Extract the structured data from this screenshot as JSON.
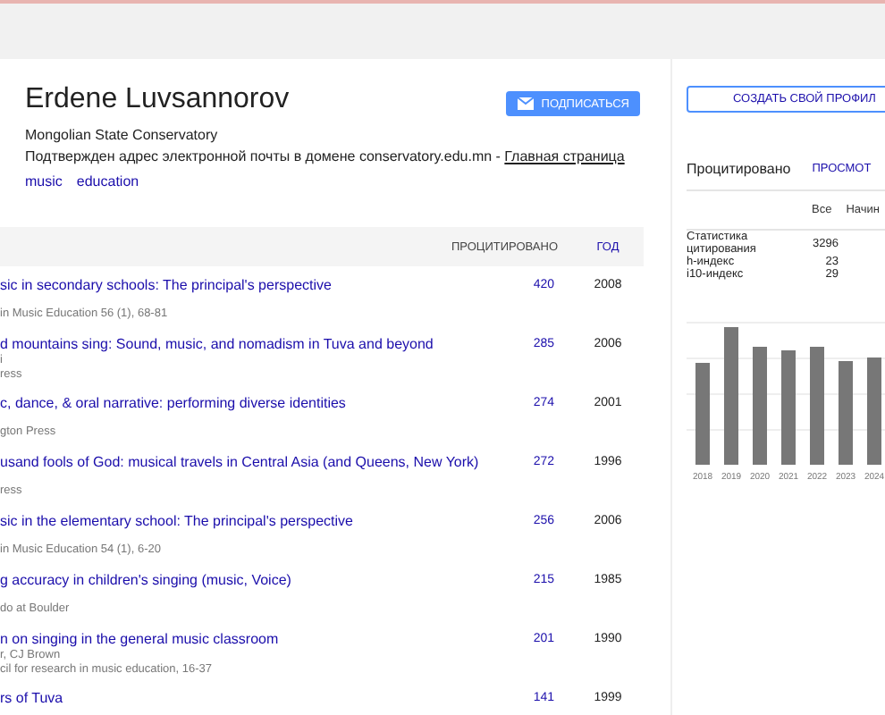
{
  "profile": {
    "name": "Erdene Luvsannorov",
    "affiliation": "Mongolian State Conservatory",
    "verified": "Подтвержден адрес электронной почты в домене conservatory.edu.mn - ",
    "homepage_link": "Главная страница",
    "interests": [
      "music",
      "education"
    ],
    "follow_button": "ПОДПИСАТЬСЯ"
  },
  "table": {
    "columns": [
      "ПРОЦИТИРОВАНО",
      "ГОД"
    ],
    "rows": [
      {
        "title": "sic in secondary schools: The principal's perspective",
        "lines": [
          "in Music Education 56 (1), 68-81"
        ],
        "cited": "420",
        "year": "2008"
      },
      {
        "title": "d mountains sing: Sound, music, and nomadism in Tuva and beyond",
        "lines": [
          "i",
          "ress"
        ],
        "cited": "285",
        "year": "2006"
      },
      {
        "title": "c, dance, & oral narrative: performing diverse identities",
        "lines": [
          "gton Press"
        ],
        "cited": "274",
        "year": "2001"
      },
      {
        "title": "usand fools of God: musical travels in Central Asia (and Queens, New York)",
        "lines": [
          "ress"
        ],
        "cited": "272",
        "year": "1996"
      },
      {
        "title": "sic in the elementary school: The principal's perspective",
        "lines": [
          "in Music Education 54 (1), 6-20"
        ],
        "cited": "256",
        "year": "2006"
      },
      {
        "title": "g accuracy in children's singing (music, Voice)",
        "lines": [
          "do at Boulder"
        ],
        "cited": "215",
        "year": "1985"
      },
      {
        "title": "n on singing in the general music classroom",
        "lines": [
          "r, CJ Brown",
          "cil for research in music education, 16-37"
        ],
        "cited": "201",
        "year": "1990"
      },
      {
        "title": "rs of Tuva",
        "lines": [],
        "cited": "141",
        "year": "1999"
      }
    ]
  },
  "sidebar": {
    "create_button": "СОЗДАТЬ СВОЙ ПРОФИЛ",
    "heading": "Процитировано",
    "view_link": "ПРОСМОТ",
    "columns": [
      "Все",
      "Начин"
    ],
    "stats": [
      {
        "label": "Статистика цитирования",
        "all": "3296"
      },
      {
        "label": "h-индекс",
        "all": "23"
      },
      {
        "label": "i10-индекс",
        "all": "29"
      }
    ],
    "chart_years": [
      "2018",
      "2019",
      "2020",
      "2021",
      "2022",
      "2023",
      "2024"
    ]
  }
}
